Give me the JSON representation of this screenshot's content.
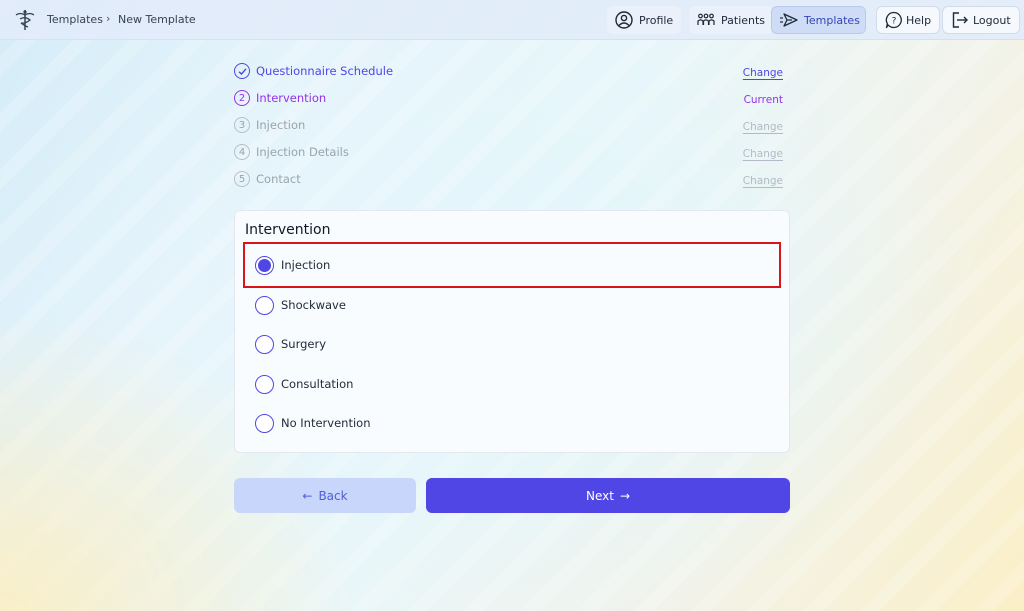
{
  "header": {
    "breadcrumb": [
      "Templates",
      "New Template"
    ],
    "breadcrumb_separator": "›",
    "nav": [
      {
        "label": "Profile",
        "icon": "user-circle-icon"
      },
      {
        "label": "Patients",
        "icon": "people-group-icon"
      },
      {
        "label": "Templates",
        "icon": "send-plane-icon",
        "active": true
      },
      {
        "label": "Help",
        "icon": "help-bubble-icon"
      },
      {
        "label": "Logout",
        "icon": "logout-icon"
      }
    ]
  },
  "stepper": {
    "steps": [
      {
        "marker": "✓",
        "label": "Questionnaire Schedule",
        "action": "Change",
        "state": "done"
      },
      {
        "marker": "2",
        "label": "Intervention",
        "action": "Current",
        "state": "current"
      },
      {
        "marker": "3",
        "label": "Injection",
        "action": "Change",
        "state": "upcoming"
      },
      {
        "marker": "4",
        "label": "Injection Details",
        "action": "Change",
        "state": "upcoming"
      },
      {
        "marker": "5",
        "label": "Contact",
        "action": "Change",
        "state": "upcoming"
      }
    ]
  },
  "intervention": {
    "title": "Intervention",
    "options": [
      {
        "label": "Injection",
        "selected": true
      },
      {
        "label": "Shockwave",
        "selected": false
      },
      {
        "label": "Surgery",
        "selected": false
      },
      {
        "label": "Consultation",
        "selected": false
      },
      {
        "label": "No Intervention",
        "selected": false
      }
    ]
  },
  "actions": {
    "back_label": "Back",
    "back_arrow": "←",
    "next_label": "Next",
    "next_arrow": "→"
  },
  "colors": {
    "accent": "#4f46e5",
    "current_step": "#9333ea",
    "highlight_border": "#d9141b"
  }
}
